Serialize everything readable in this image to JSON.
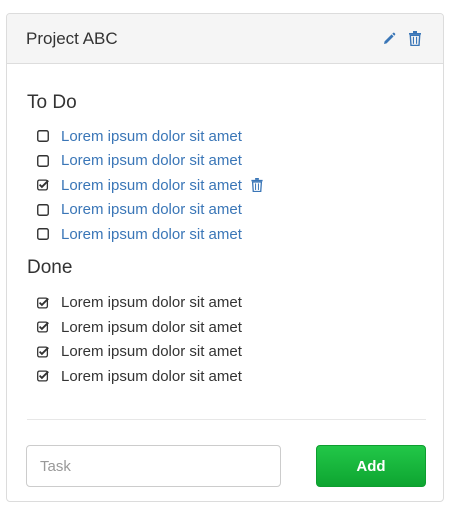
{
  "panel": {
    "title": "Project ABC",
    "edit_icon": "pencil-icon",
    "delete_icon": "trash-icon"
  },
  "todo": {
    "heading": "To Do",
    "items": [
      {
        "label": "Lorem ipsum dolor sit amet",
        "checked": false,
        "show_delete": false
      },
      {
        "label": "Lorem ipsum dolor sit amet",
        "checked": false,
        "show_delete": false
      },
      {
        "label": "Lorem ipsum dolor sit amet",
        "checked": true,
        "show_delete": true
      },
      {
        "label": "Lorem ipsum dolor sit amet",
        "checked": false,
        "show_delete": false
      },
      {
        "label": "Lorem ipsum dolor sit amet",
        "checked": false,
        "show_delete": false
      }
    ]
  },
  "done": {
    "heading": "Done",
    "items": [
      {
        "label": "Lorem ipsum dolor sit amet",
        "checked": true
      },
      {
        "label": "Lorem ipsum dolor sit amet",
        "checked": true
      },
      {
        "label": "Lorem ipsum dolor sit amet",
        "checked": true
      },
      {
        "label": "Lorem ipsum dolor sit amet",
        "checked": true
      }
    ]
  },
  "add_form": {
    "input_placeholder": "Task",
    "input_value": "",
    "button_label": "Add"
  },
  "colors": {
    "link": "#3a76b7",
    "icon": "#3a76b7",
    "add_button": "#13b339"
  }
}
